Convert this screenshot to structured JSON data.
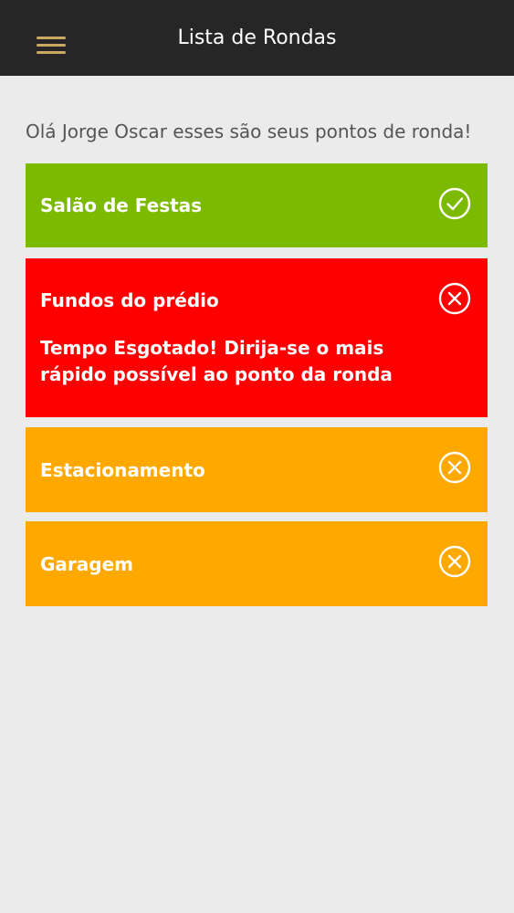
{
  "header": {
    "title": "Lista de Rondas"
  },
  "greeting": "Olá Jorge Oscar esses são seus pontos de ronda!",
  "colors": {
    "header_bg": "#262626",
    "menu_icon": "#c9a862",
    "done": "#7cba00",
    "overdue": "#ff0000",
    "pending": "#ffa800",
    "background": "#ebebeb"
  },
  "rounds": [
    {
      "name": "Salão de Festas",
      "status": "done",
      "icon": "check-circle-icon"
    },
    {
      "name": "Fundos do prédio",
      "status": "overdue",
      "icon": "x-circle-icon",
      "message": "Tempo Esgotado! Dirija-se o mais rápido possível ao ponto da ronda"
    },
    {
      "name": "Estacionamento",
      "status": "pending",
      "icon": "x-circle-icon"
    },
    {
      "name": "Garagem",
      "status": "pending",
      "icon": "x-circle-icon"
    }
  ]
}
